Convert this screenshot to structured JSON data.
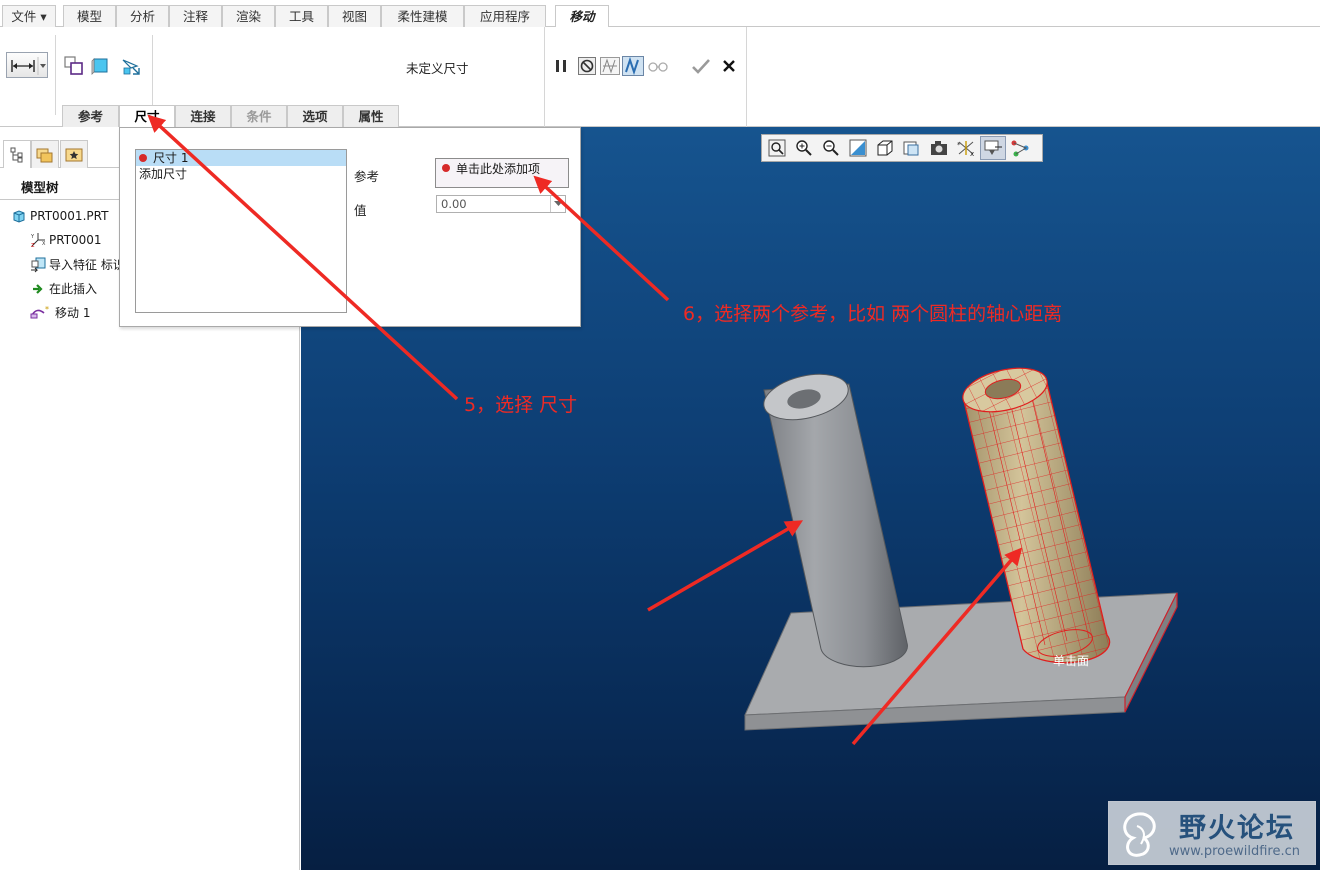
{
  "menubar": {
    "tabs": [
      {
        "label": "文件 ▾"
      },
      {
        "label": "模型"
      },
      {
        "label": "分析"
      },
      {
        "label": "注释"
      },
      {
        "label": "渲染"
      },
      {
        "label": "工具"
      },
      {
        "label": "视图"
      },
      {
        "label": "柔性建模"
      },
      {
        "label": "应用程序"
      },
      {
        "label": "移动"
      }
    ]
  },
  "ribbon": {
    "status_label": "未定义尺寸",
    "subtabs": [
      {
        "label": "参考"
      },
      {
        "label": "尺寸"
      },
      {
        "label": "连接"
      },
      {
        "label": "条件"
      },
      {
        "label": "选项"
      },
      {
        "label": "属性"
      }
    ],
    "icons": {
      "dimension": "dimension-icon",
      "pause": "pause-icon",
      "stop": "no-preview-icon",
      "check": "ok-check-icon",
      "close": "cancel-x-icon"
    }
  },
  "model_tree": {
    "title": "模型树",
    "items": [
      {
        "label": "PRT0001.PRT",
        "icon": "part-icon"
      },
      {
        "label": "PRT0001",
        "icon": "csys-icon"
      },
      {
        "label": "导入特征 标识",
        "icon": "import-feature-icon"
      },
      {
        "label": "在此插入",
        "icon": "insert-here-arrow-icon"
      },
      {
        "label": "移动 1",
        "icon": "move-feature-icon"
      }
    ]
  },
  "dim_panel": {
    "list": [
      {
        "label": "尺寸 1"
      },
      {
        "label": "添加尺寸"
      }
    ],
    "ref_label": "参考",
    "ref_value": "单击此处添加项",
    "value_label": "值",
    "value": "0.00"
  },
  "viewport": {
    "scene_label": "单击面"
  },
  "annotations": {
    "step5": "5，选择  尺寸",
    "step6": "6，选择两个参考，比如  两个圆柱的轴心距离"
  },
  "watermark": {
    "title": "野火论坛",
    "url": "www.proewildfire.cn"
  },
  "colors": {
    "accent_red": "#ee2a24",
    "viewport_top": "#16548f",
    "viewport_bottom": "#061f42",
    "highlight": "#b9ddf6"
  }
}
